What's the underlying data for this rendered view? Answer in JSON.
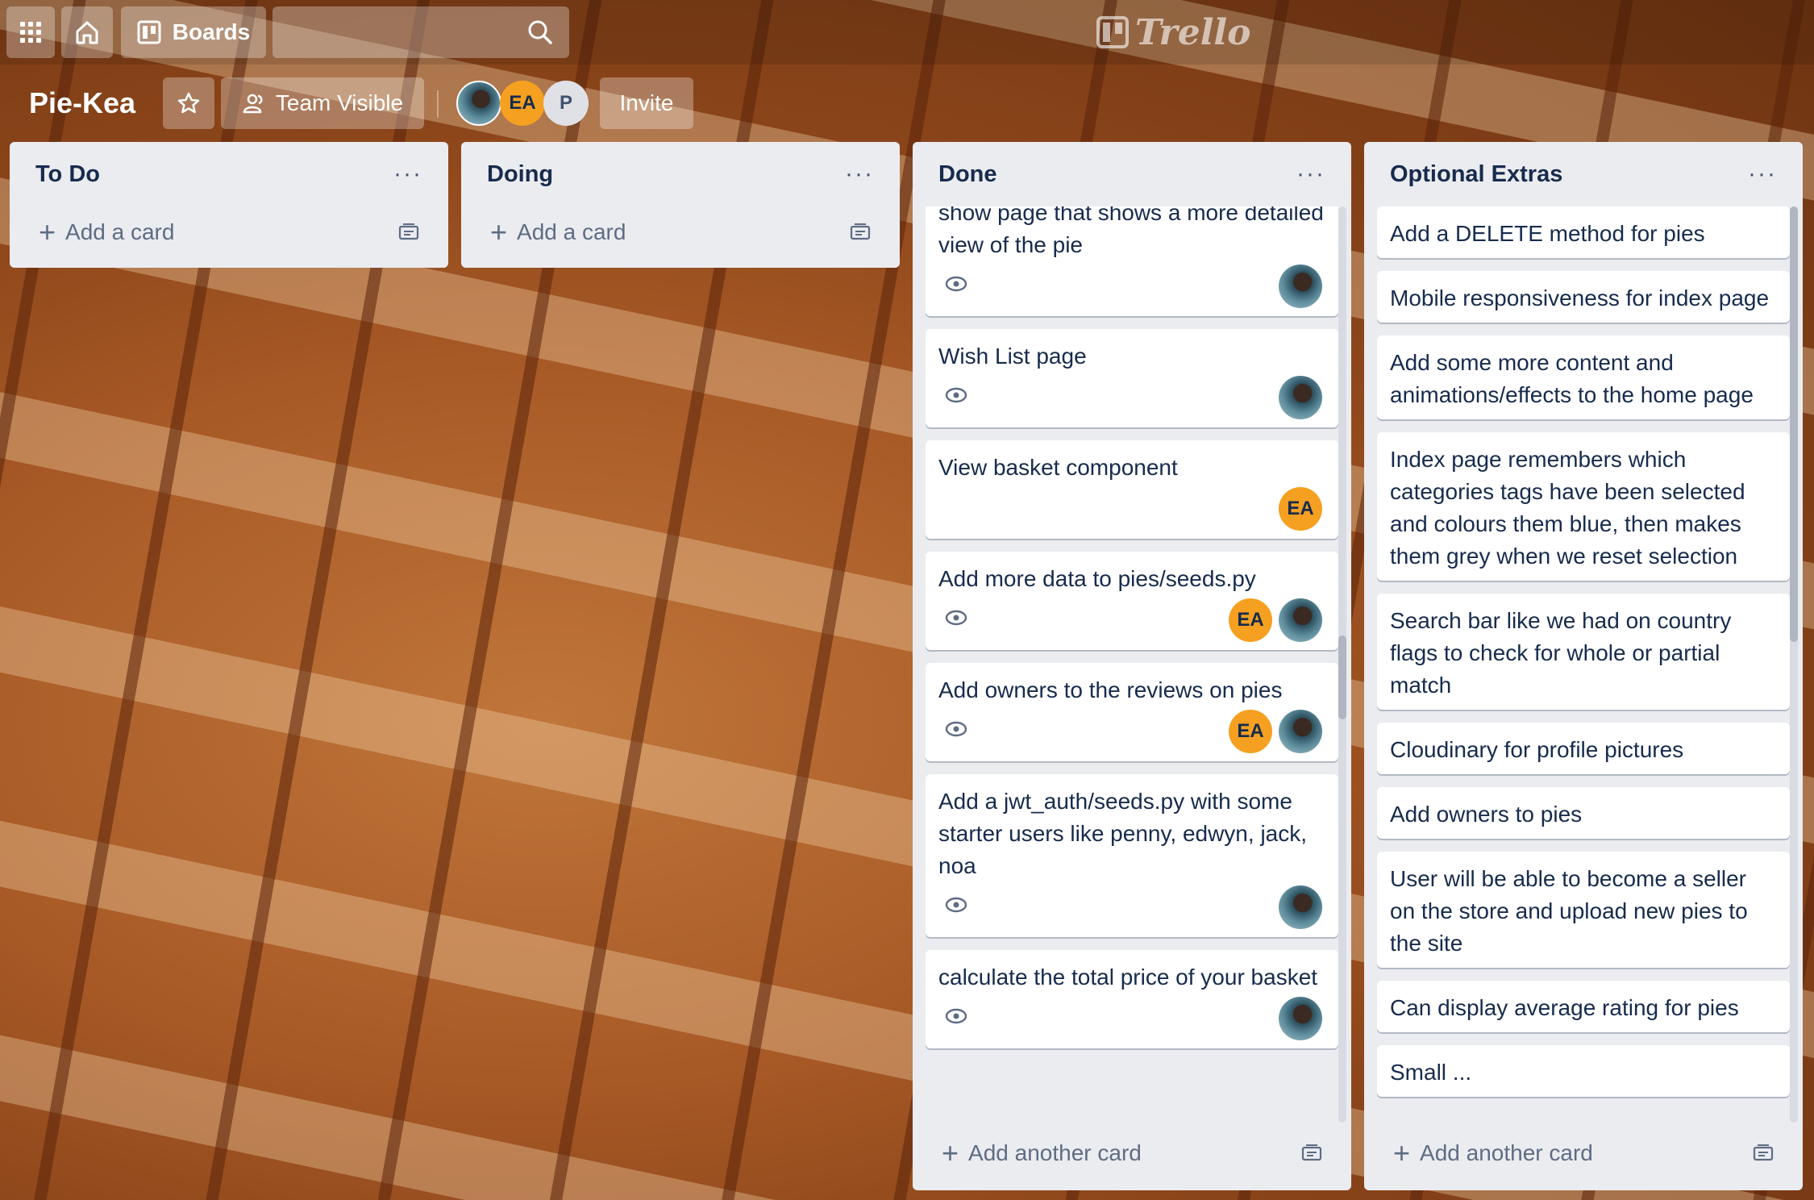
{
  "topbar": {
    "apps_icon": "grid-icon",
    "home_icon": "home-icon",
    "boards_label": "Boards",
    "search_icon": "search-icon",
    "logo_text": "Trello"
  },
  "board": {
    "title": "Pie-Kea",
    "star_icon": "star-icon",
    "visibility_label": "Team Visible",
    "invite_label": "Invite",
    "members": [
      {
        "initials": "",
        "type": "photo"
      },
      {
        "initials": "EA",
        "type": "initials"
      },
      {
        "initials": "P",
        "type": "initials"
      }
    ]
  },
  "lists": [
    {
      "title": "To Do",
      "menu": "···",
      "add_label": "Add a card",
      "cards": []
    },
    {
      "title": "Doing",
      "menu": "···",
      "add_label": "Add a card",
      "cards": []
    },
    {
      "title": "Done",
      "menu": "···",
      "add_label": "Add another card",
      "cards": [
        {
          "text": "show page that shows a more detailed view of the pie",
          "watch": true,
          "members": [
            "photo"
          ]
        },
        {
          "text": "Wish List page",
          "watch": true,
          "members": [
            "photo"
          ]
        },
        {
          "text": "View basket component",
          "watch": false,
          "members": [
            "EA"
          ]
        },
        {
          "text": "Add more data to pies/seeds.py",
          "watch": true,
          "members": [
            "EA",
            "photo"
          ]
        },
        {
          "text": "Add owners to the reviews on pies",
          "watch": true,
          "members": [
            "EA",
            "photo"
          ]
        },
        {
          "text": "Add a jwt_auth/seeds.py with some starter users like penny, edwyn, jack, noa",
          "watch": true,
          "members": [
            "photo"
          ]
        },
        {
          "text": "calculate the total price of your basket",
          "watch": true,
          "members": [
            "photo"
          ]
        }
      ]
    },
    {
      "title": "Optional Extras",
      "menu": "···",
      "add_label": "Add another card",
      "cards": [
        {
          "text": "Add a DELETE method for pies"
        },
        {
          "text": "Mobile responsiveness for index page"
        },
        {
          "text": "Add some more content and animations/effects to the home page"
        },
        {
          "text": "Index page remembers which categories tags have been selected and colours them blue, then makes them grey when we reset selection"
        },
        {
          "text": "Search bar like we had on country flags to check for whole or partial match"
        },
        {
          "text": "Cloudinary for profile pictures"
        },
        {
          "text": "Add owners to pies"
        },
        {
          "text": "User will be able to become a seller on the store and upload new pies to the site"
        },
        {
          "text": "Can display average rating for pies"
        },
        {
          "text": "Small ... "
        }
      ]
    }
  ]
}
